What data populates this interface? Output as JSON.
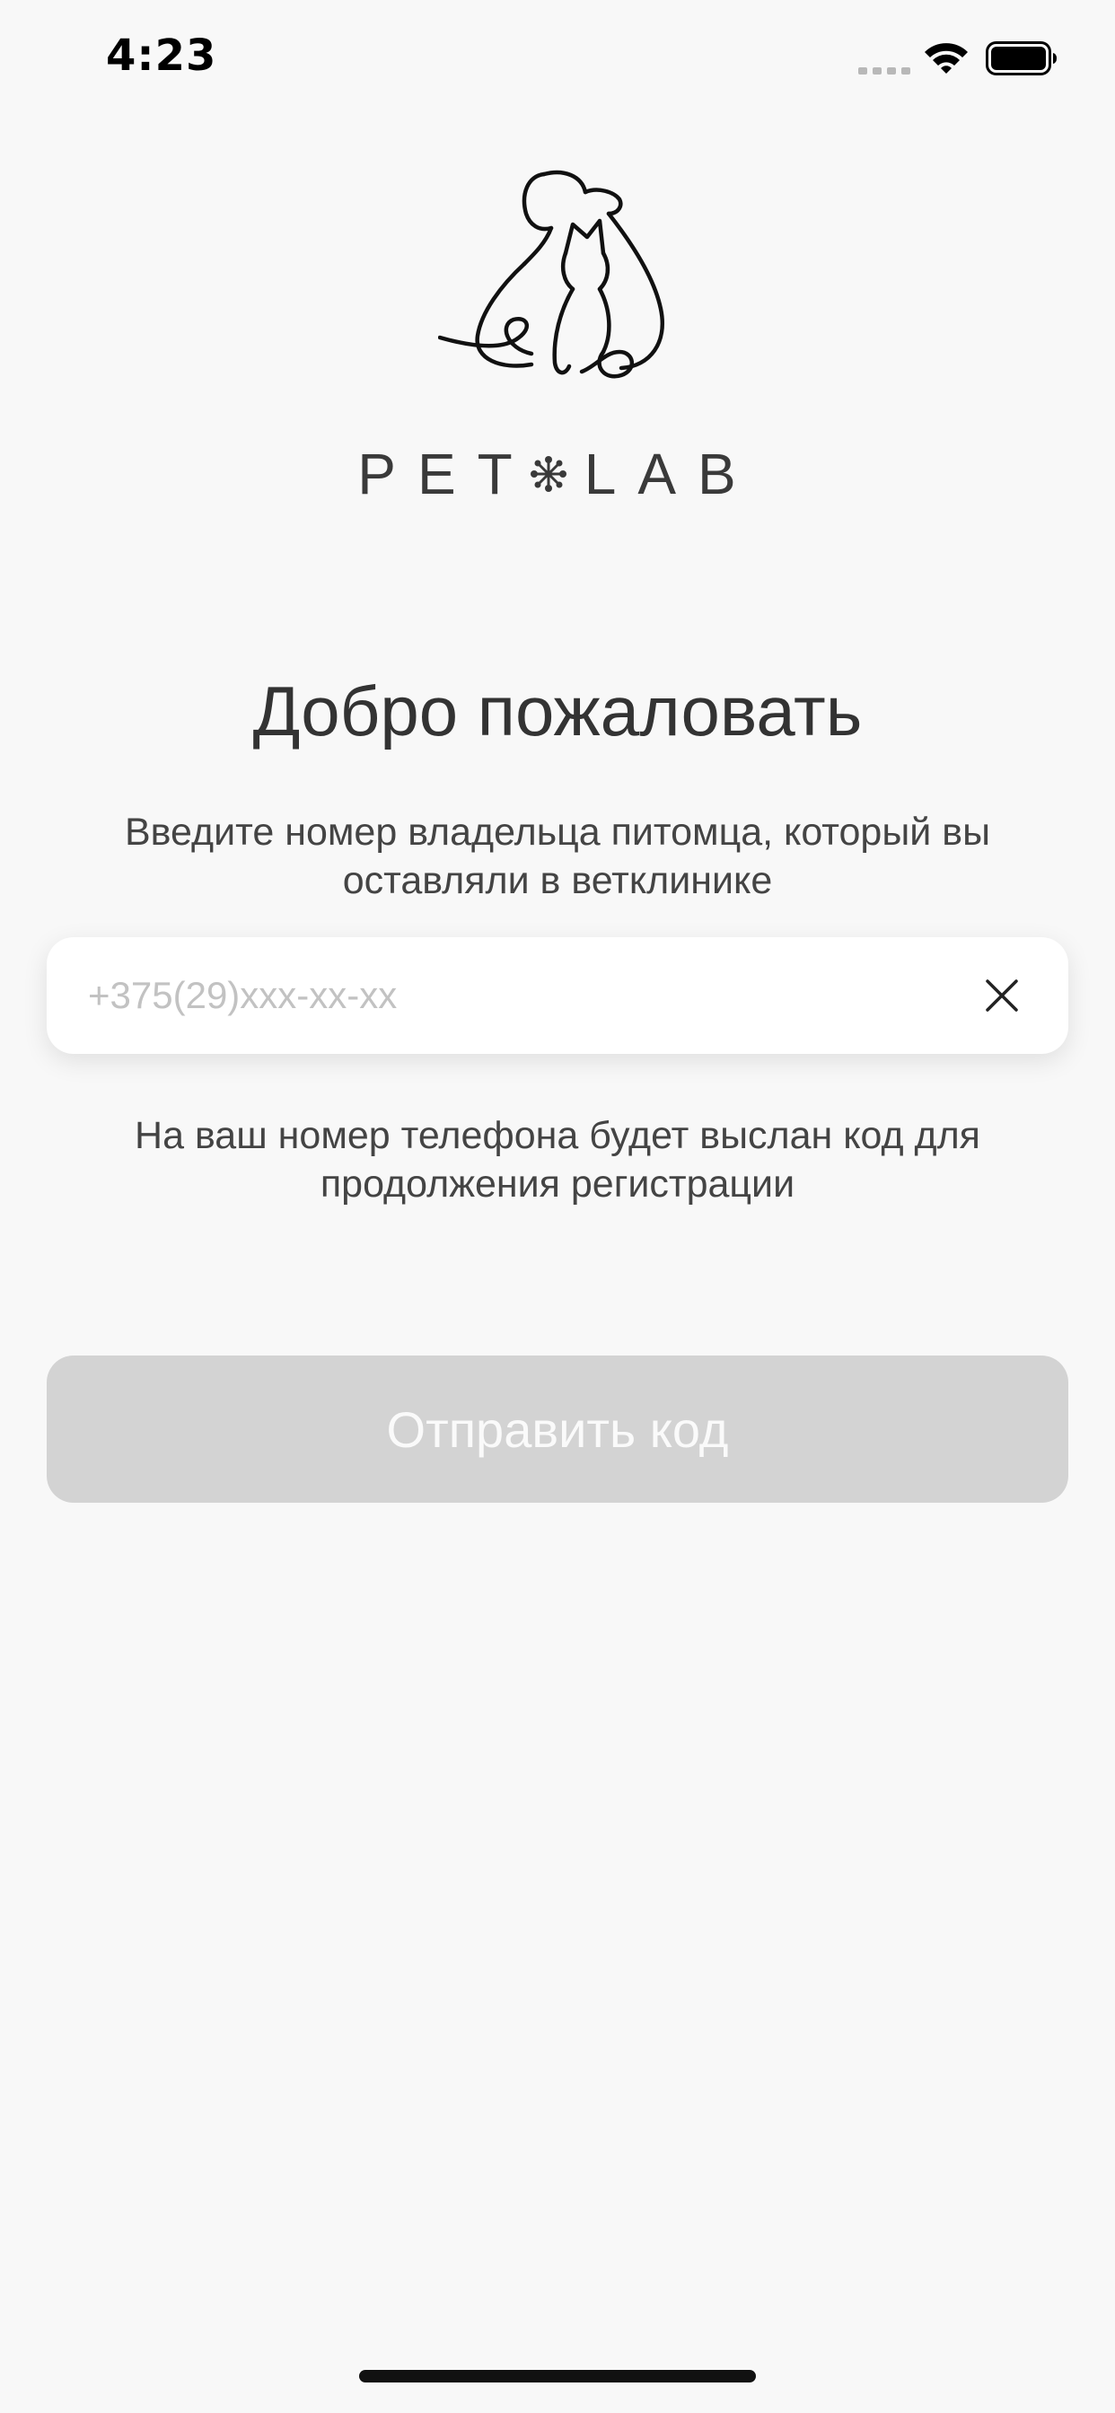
{
  "status_bar": {
    "time": "4:23",
    "signal_icon": "cellular-dots-icon",
    "wifi_icon": "wifi-icon",
    "battery_icon": "battery-full-icon"
  },
  "brand": {
    "logo_icon": "dog-and-cat-line-art-icon",
    "word_left": "PET",
    "separator_icon": "snowflake-icon",
    "word_right": "LAB"
  },
  "welcome": {
    "title": "Добро пожаловать",
    "subtitle": "Введите номер владельца питомца, который вы оставляли в ветклинике"
  },
  "phone_field": {
    "value": "",
    "placeholder": "+375(29)xxx-xx-xx",
    "clear_icon": "close-icon"
  },
  "hint": "На ваш номер телефона будет выслан код для продолжения регистрации",
  "send_button": {
    "label": "Отправить код",
    "state": "disabled"
  },
  "colors": {
    "background": "#f8f8f8",
    "text": "#333333",
    "placeholder": "#c2c2c2",
    "button_disabled": "#d3d3d3",
    "button_text": "#fafafa"
  }
}
